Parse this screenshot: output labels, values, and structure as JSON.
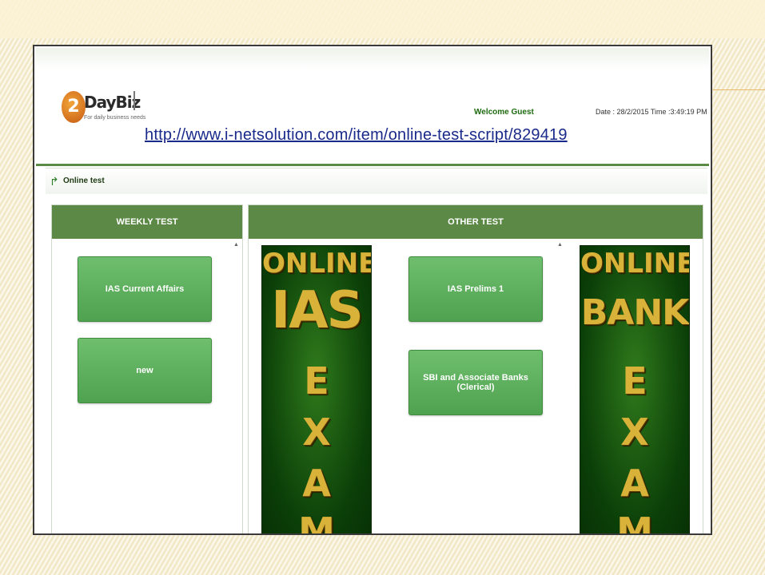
{
  "logo": {
    "glyph": "2",
    "brand": "DayBiz",
    "tagline": "For daily business needs"
  },
  "header": {
    "welcome": "Welcome Guest",
    "datetime": "Date : 28/2/2015 Time :3:49:19 PM",
    "url": "http://www.i-netsolution.com/item/online-test-script/829419"
  },
  "subnav": {
    "icon": "online-test-icon",
    "label": "Online test"
  },
  "weekly": {
    "title": "WEEKLY TEST",
    "buttons": [
      "IAS Current Affairs",
      "new"
    ]
  },
  "other": {
    "title": "OTHER TEST",
    "buttons": [
      "IAS Prelims 1",
      "SBI and Associate Banks (Clerical)"
    ]
  },
  "banners": {
    "ias": {
      "line1": "ONLINE",
      "line2": "IAS",
      "letters": [
        "E",
        "X",
        "A",
        "M"
      ]
    },
    "bank": {
      "line1": "ONLINE",
      "line2": "BANK",
      "letters": [
        "E",
        "X",
        "A",
        "M"
      ]
    }
  },
  "colors": {
    "panel_header": "#5c8a46",
    "button": "#5cae5c",
    "banner_text": "#d9b23a",
    "link": "#1a2a8a"
  }
}
